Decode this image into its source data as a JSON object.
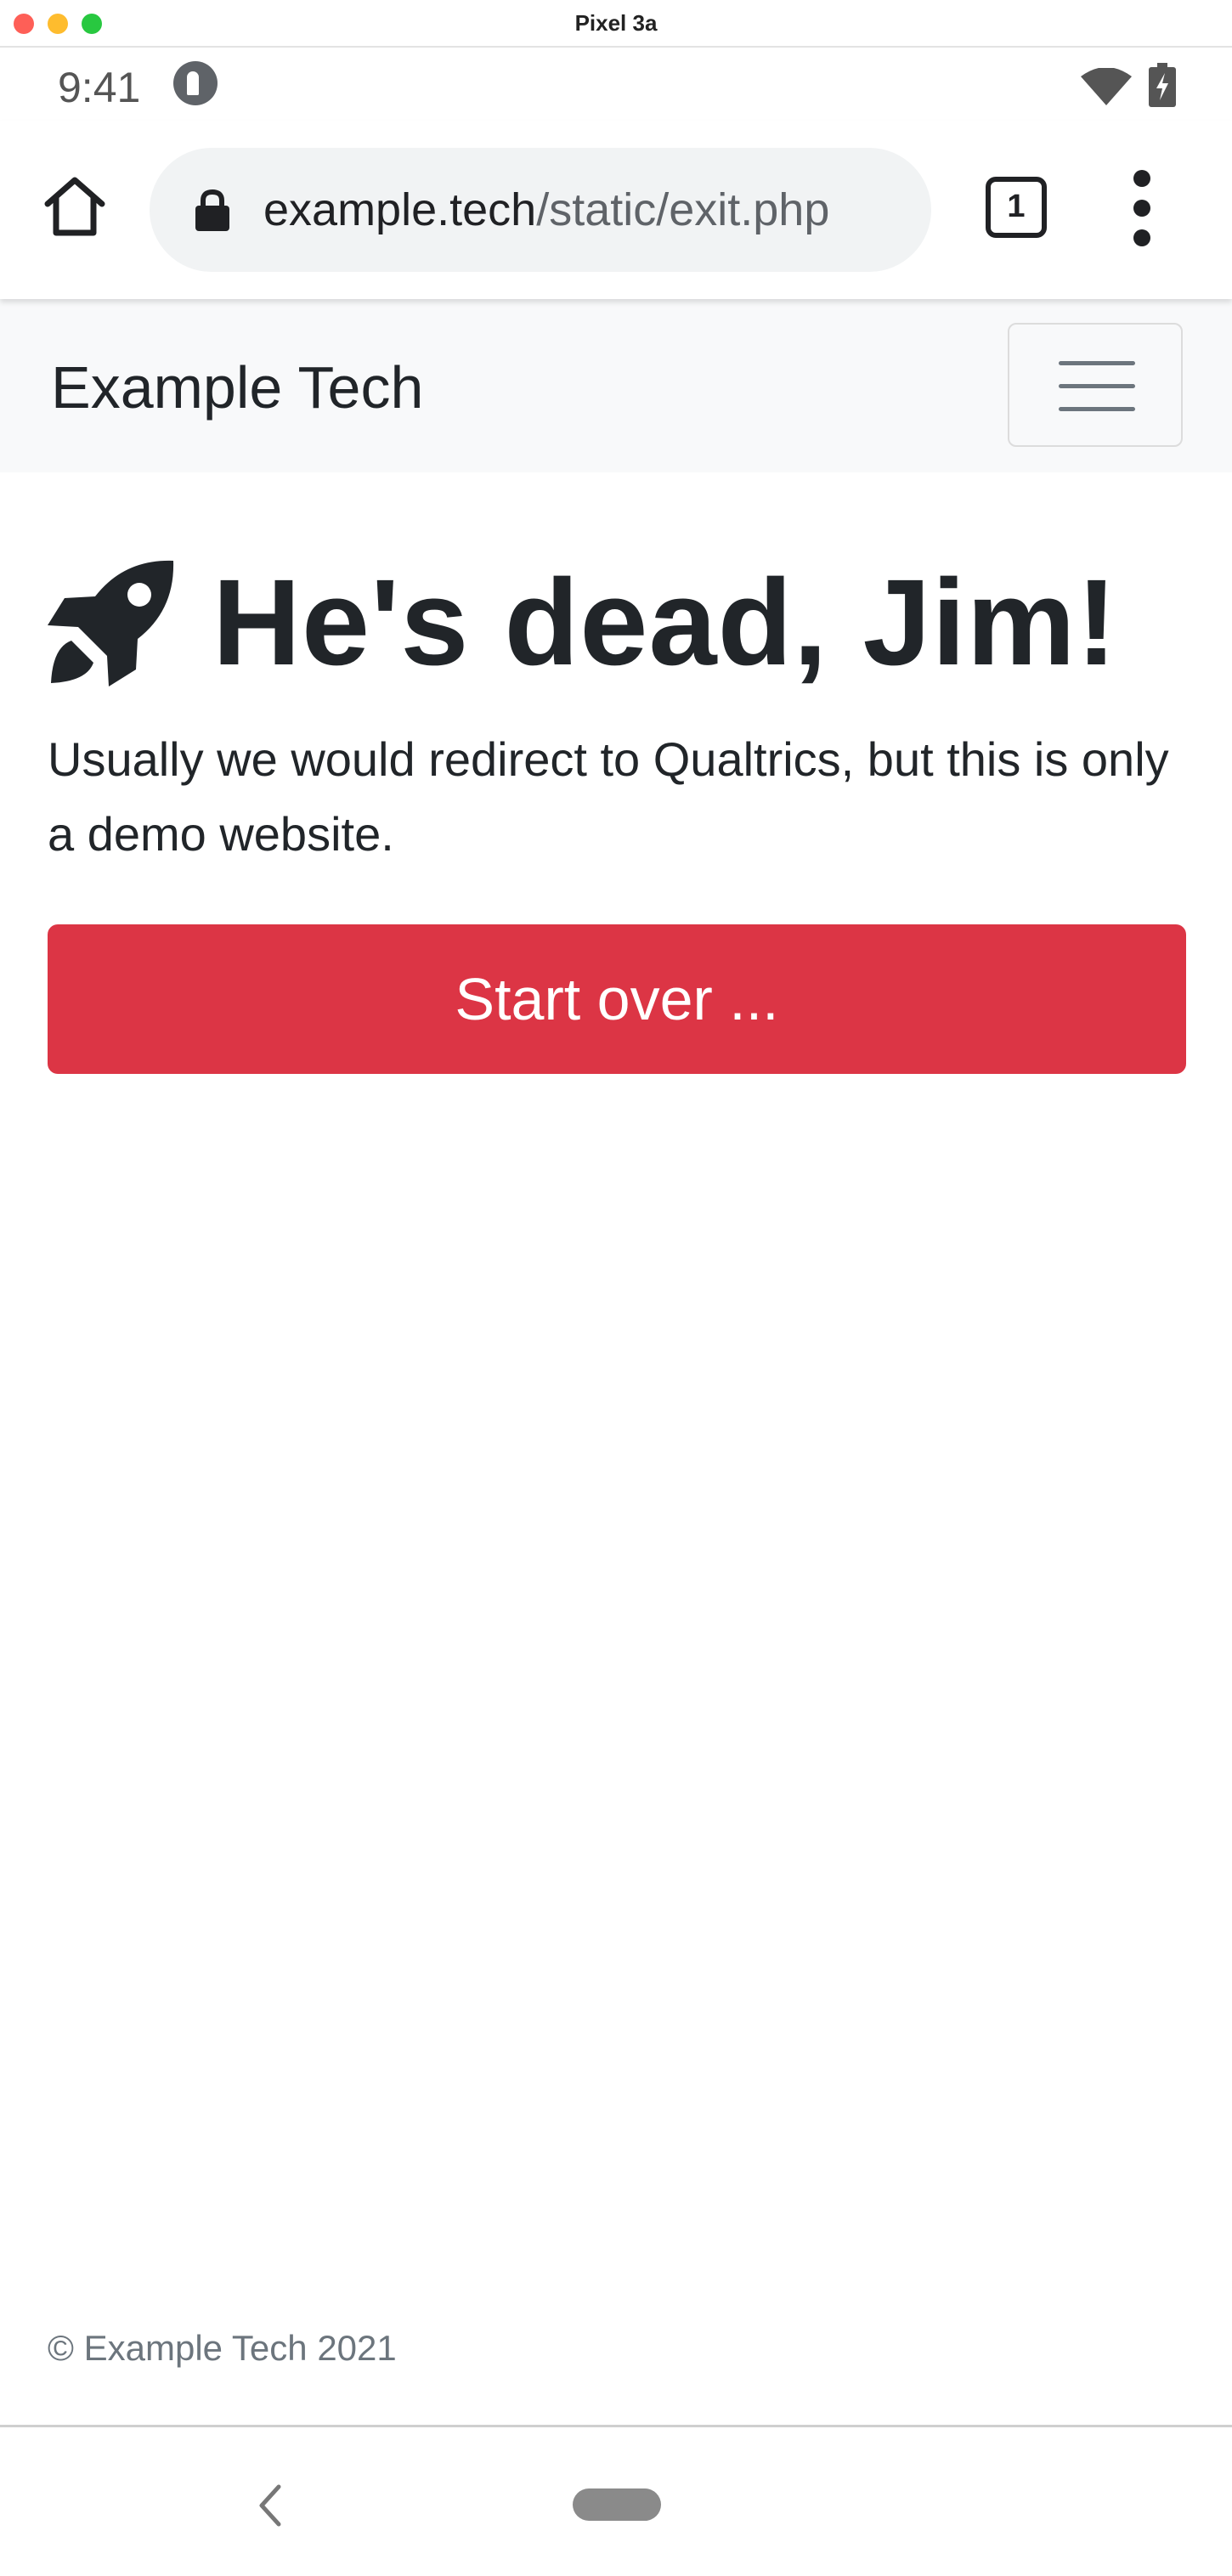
{
  "window": {
    "title": "Pixel 3a"
  },
  "status_bar": {
    "time": "9:41"
  },
  "browser": {
    "url_host": "example.tech",
    "url_path": "/static/exit.php",
    "tab_count": "1"
  },
  "navbar": {
    "brand": "Example Tech"
  },
  "main": {
    "title": "He's dead, Jim!",
    "lead": "Usually we would redirect to Qualtrics, but this is only a demo website.",
    "start_button": "Start over ..."
  },
  "footer": {
    "copyright": "© Example Tech 2021"
  },
  "icons": {
    "home": "home-icon",
    "lock": "lock-icon",
    "menu": "more-vert-icon",
    "hamburger": "hamburger-menu-icon",
    "rocket": "rocket-icon",
    "wifi": "wifi-icon",
    "battery": "battery-charging-icon",
    "back": "back-chevron-icon"
  },
  "colors": {
    "danger": "#dc3545",
    "navbar_bg": "#f8f9fa",
    "text": "#212529",
    "muted": "#6c757d"
  }
}
